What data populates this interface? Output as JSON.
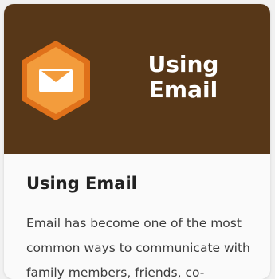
{
  "card": {
    "banner": {
      "title_line1": "Using",
      "title_line2": "Email",
      "background": "#573718",
      "icon": "envelope-hexagon-icon",
      "icon_colors": {
        "outer": "#e0711a",
        "inner": "#f39c3c",
        "envelope": "#ffffff"
      }
    },
    "title": "Using Email",
    "description": "Email has become one of the most common ways to communicate with family members, friends, co-"
  }
}
